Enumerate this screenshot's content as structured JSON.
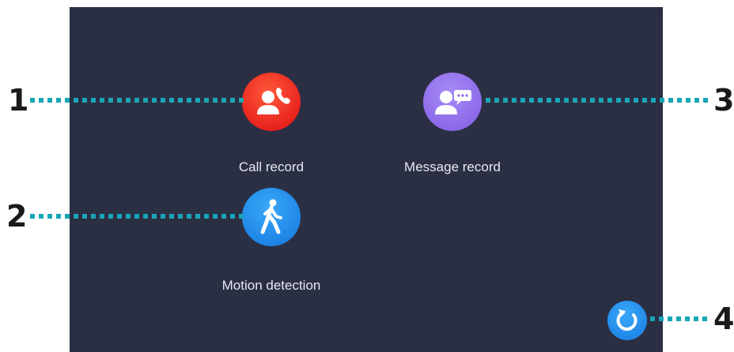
{
  "apps": {
    "call_record": {
      "label": "Call record",
      "icon": "call-record-icon",
      "color": "#e8231e"
    },
    "message_record": {
      "label": "Message record",
      "icon": "message-record-icon",
      "color": "#8c6ae9"
    },
    "motion_detection": {
      "label": "Motion detection",
      "icon": "motion-detection-icon",
      "color": "#1e86e6"
    }
  },
  "refresh_button": {
    "icon": "refresh-icon",
    "color": "#1e86e6"
  },
  "callouts": {
    "one": "1",
    "two": "2",
    "three": "3",
    "four": "4",
    "line_color": "#17a6b8"
  },
  "screen": {
    "background": "#2b2f44"
  }
}
